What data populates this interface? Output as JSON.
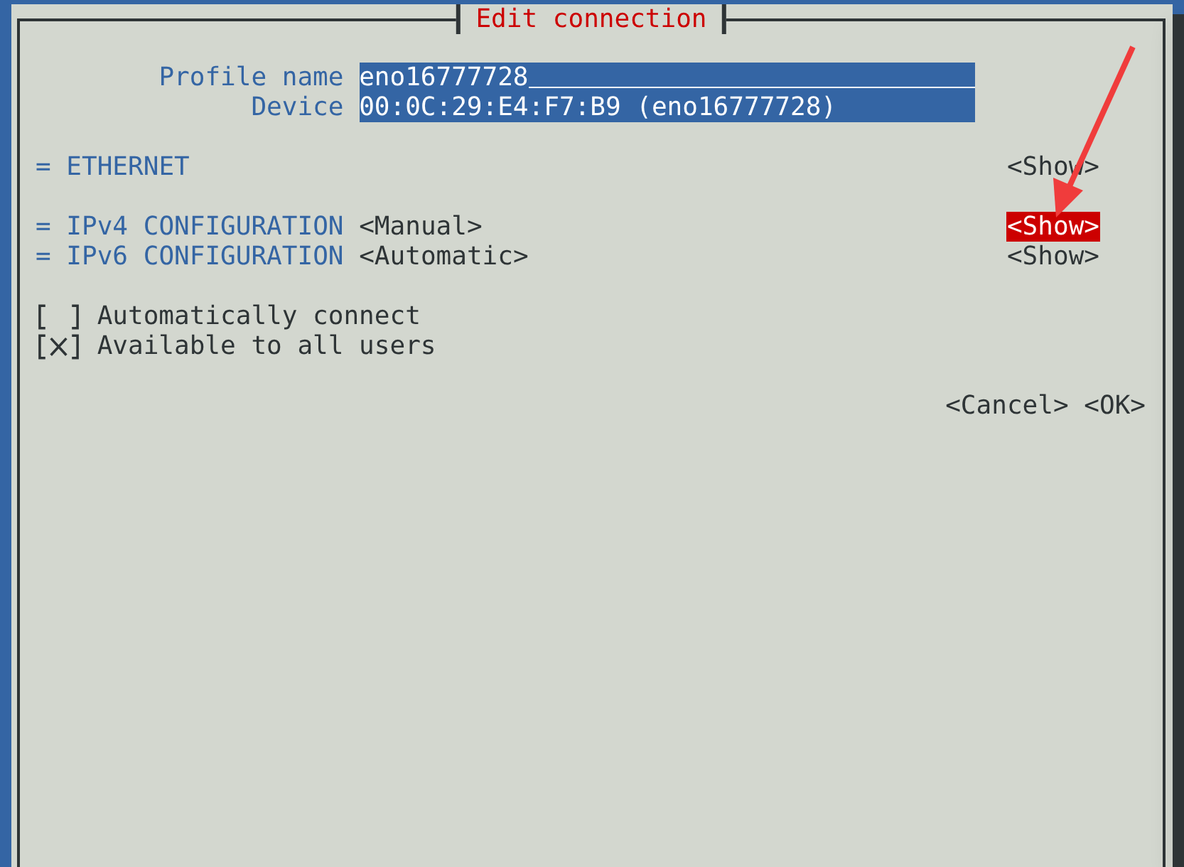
{
  "dialog": {
    "title": "Edit connection"
  },
  "fields": [
    {
      "label": "Profile name",
      "value": "eno16777728",
      "kind": "entry"
    },
    {
      "label": "Device",
      "value": "00:0C:29:E4:F7:B9 (eno16777728)",
      "kind": "text"
    }
  ],
  "sections": [
    {
      "name": "= ETHERNET",
      "show": "<Show>",
      "selected": false
    },
    {
      "name": "= IPv4 CONFIGURATION",
      "mode": "<Manual>",
      "show": "<Show>",
      "selected": true
    },
    {
      "name": "= IPv6 CONFIGURATION",
      "mode": "<Automatic>",
      "show": "<Show>",
      "selected": false
    }
  ],
  "options": [
    {
      "label": "Automatically connect",
      "checked": false
    },
    {
      "label": "Available to all users",
      "checked": true
    }
  ],
  "buttons": [
    "<Cancel>",
    "<OK>"
  ]
}
